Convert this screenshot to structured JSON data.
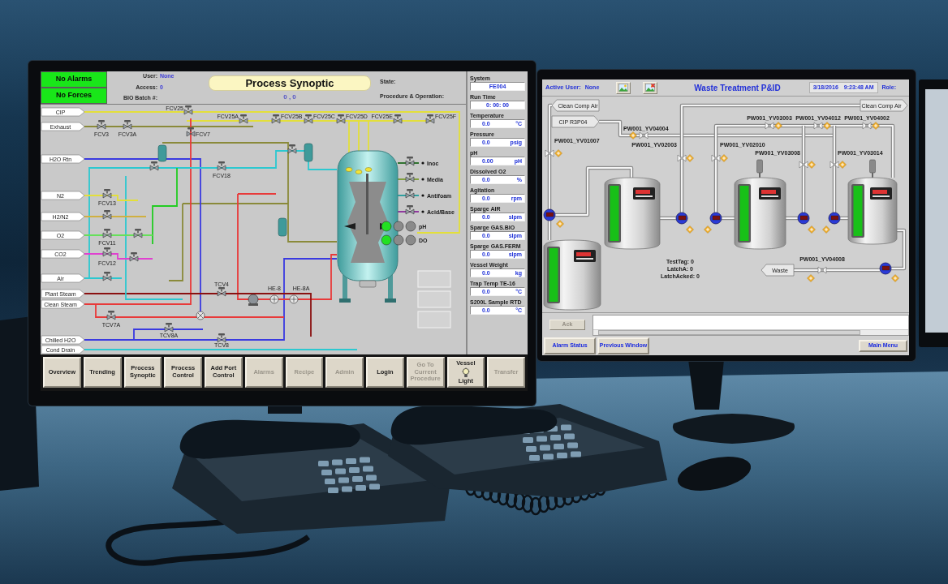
{
  "left_screen": {
    "status": [
      {
        "label": "No Alarms",
        "on": true
      },
      {
        "label": "No Forces",
        "on": true
      }
    ],
    "user": {
      "label": "User:",
      "value": "None"
    },
    "access": {
      "label": "Access:",
      "value": "0"
    },
    "batch": {
      "label": "BIO Batch #:"
    },
    "title": "Process Synoptic",
    "title_value": "0 , 0",
    "state_label": "State:",
    "procedure_label": "Procedure & Operation:",
    "inlets": [
      "CIP",
      "Exhaust",
      "H2O Rtn",
      "N2",
      "H2/N2",
      "O2",
      "CO2",
      "Air",
      "Plant Steam",
      "Clean Steam",
      "Chilled H2O",
      "Cond Drain"
    ],
    "equipment_tags": [
      "FCV25",
      "FCV25A",
      "FCV25B",
      "FCV25C",
      "FCV25D",
      "FCV25E",
      "FCV25F",
      "FCV3",
      "FCV3A",
      "FCV7",
      "FCV18",
      "FCV13",
      "FCV11",
      "FCV12",
      "TCV4",
      "HE-8",
      "HE-8A",
      "TCV7A",
      "TCV8A",
      "TCV8"
    ],
    "additions": [
      "Inoc",
      "Media",
      "Antifoam",
      "Acid/Base"
    ],
    "probes": [
      "pH",
      "DO"
    ],
    "panel_buttons": [
      {
        "disabled": true
      },
      {
        "disabled": true
      },
      {
        "disabled": true
      }
    ],
    "readings": [
      {
        "label": "System",
        "value": "FE004"
      },
      {
        "label": "Run Time",
        "value": "0: 00: 00"
      },
      {
        "label": "Temperature",
        "value": "0.0",
        "unit": "°C"
      },
      {
        "label": "Pressure",
        "value": "0.0",
        "unit": "psig"
      },
      {
        "label": "pH",
        "value": "0.00",
        "unit": "pH"
      },
      {
        "label": "Dissolved O2",
        "value": "0.0",
        "unit": "%"
      },
      {
        "label": "Agitation",
        "value": "0.0",
        "unit": "rpm"
      },
      {
        "label": "Sparge AIR",
        "value": "0.0",
        "unit": "slpm"
      },
      {
        "label": "Sparge GAS.BIO",
        "value": "0.0",
        "unit": "slpm"
      },
      {
        "label": "Sparge GAS.FERM",
        "value": "0.0",
        "unit": "slpm"
      },
      {
        "label": "Vessel Weight",
        "value": "0.0",
        "unit": "kg"
      },
      {
        "label": "Trap Temp TE-16",
        "value": "0.0",
        "unit": "°C"
      },
      {
        "label": "S200L Sample RTD",
        "value": "0.0",
        "unit": "°C"
      }
    ],
    "nav": [
      {
        "kind": "text",
        "label": "Overview",
        "disabled": false
      },
      {
        "kind": "text",
        "label": "Trending",
        "disabled": false
      },
      {
        "kind": "text",
        "label": "Process Synoptic",
        "disabled": false
      },
      {
        "kind": "text",
        "label": "Process Control",
        "disabled": false
      },
      {
        "kind": "text",
        "label": "Add Port Control",
        "disabled": false
      },
      {
        "kind": "text",
        "label": "Alarms",
        "disabled": true
      },
      {
        "kind": "text",
        "label": "Recipe",
        "disabled": true
      },
      {
        "kind": "text",
        "label": "Admin",
        "disabled": true
      },
      {
        "kind": "text",
        "label": "Login",
        "disabled": false
      },
      {
        "kind": "text",
        "label": "Go To Current Procedure",
        "disabled": true
      },
      {
        "kind": "icon",
        "label": "Vessel",
        "sublabel": "Light",
        "disabled": false
      },
      {
        "kind": "text",
        "label": "Transfer",
        "disabled": true
      }
    ]
  },
  "right_screen": {
    "active_user": {
      "label": "Active User:",
      "value": "None"
    },
    "title": "Waste Treatment P&ID",
    "date": "3/18/2016",
    "time": "9:23:48 AM",
    "role_label": "Role:",
    "tags": [
      "Clean Comp Air",
      "CIP R3P04",
      "Clean Comp Air",
      "Waste"
    ],
    "valve_tags": [
      "PW001_YV03003",
      "PW001_YV04012",
      "PW001_YV04002",
      "PW001_YV04004",
      "PW001_YV01007",
      "PW001_YV02003",
      "PW001_YV02010",
      "PW001_YV03008",
      "PW001_YV03014",
      "PW001_YV04008"
    ],
    "tanks": [
      {
        "kind": "plain",
        "level": 1
      },
      {
        "kind": "mixer",
        "level": 1
      },
      {
        "kind": "mixer",
        "level": 1
      },
      {
        "kind": "plain",
        "level": 1
      }
    ],
    "tag_values": [
      "TestTag: 0",
      "LatchA: 0",
      "LatchAcked: 0"
    ],
    "ack": {
      "label": "Ack",
      "disabled": true
    },
    "buttons": [
      {
        "label": "Alarm Status",
        "kind": "nav"
      },
      {
        "label": "Previous Window",
        "kind": "nav"
      },
      {
        "label": "Main Menu",
        "kind": "menu"
      }
    ]
  }
}
